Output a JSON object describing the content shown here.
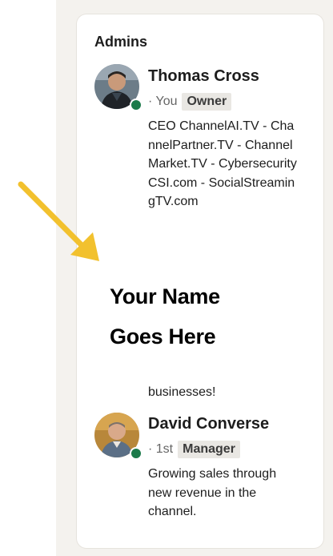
{
  "panel": {
    "title": "Admins"
  },
  "admins": [
    {
      "name": "Thomas Cross",
      "connection": "· You",
      "role": "Owner",
      "headline": "CEO ChannelAI.TV - ChannelPartner.TV - ChannelMarket.TV - CybersecurityCSI.com - SocialStreamingTV.com",
      "headline_tail": "businesses!",
      "online": true
    },
    {
      "name": "David Converse",
      "connection": "· 1st",
      "role": "Manager",
      "headline": "Growing sales through new revenue in the channel.",
      "online": true
    }
  ],
  "overlay": {
    "line1": "Your Name",
    "line2": "Goes Here"
  },
  "colors": {
    "arrow": "#f2c12e",
    "presence": "#1b7a4a",
    "badge_bg": "#e9e7e3",
    "page_bg": "#f4f2ee"
  },
  "icons": {
    "annotation": "arrow-down-right-icon"
  }
}
